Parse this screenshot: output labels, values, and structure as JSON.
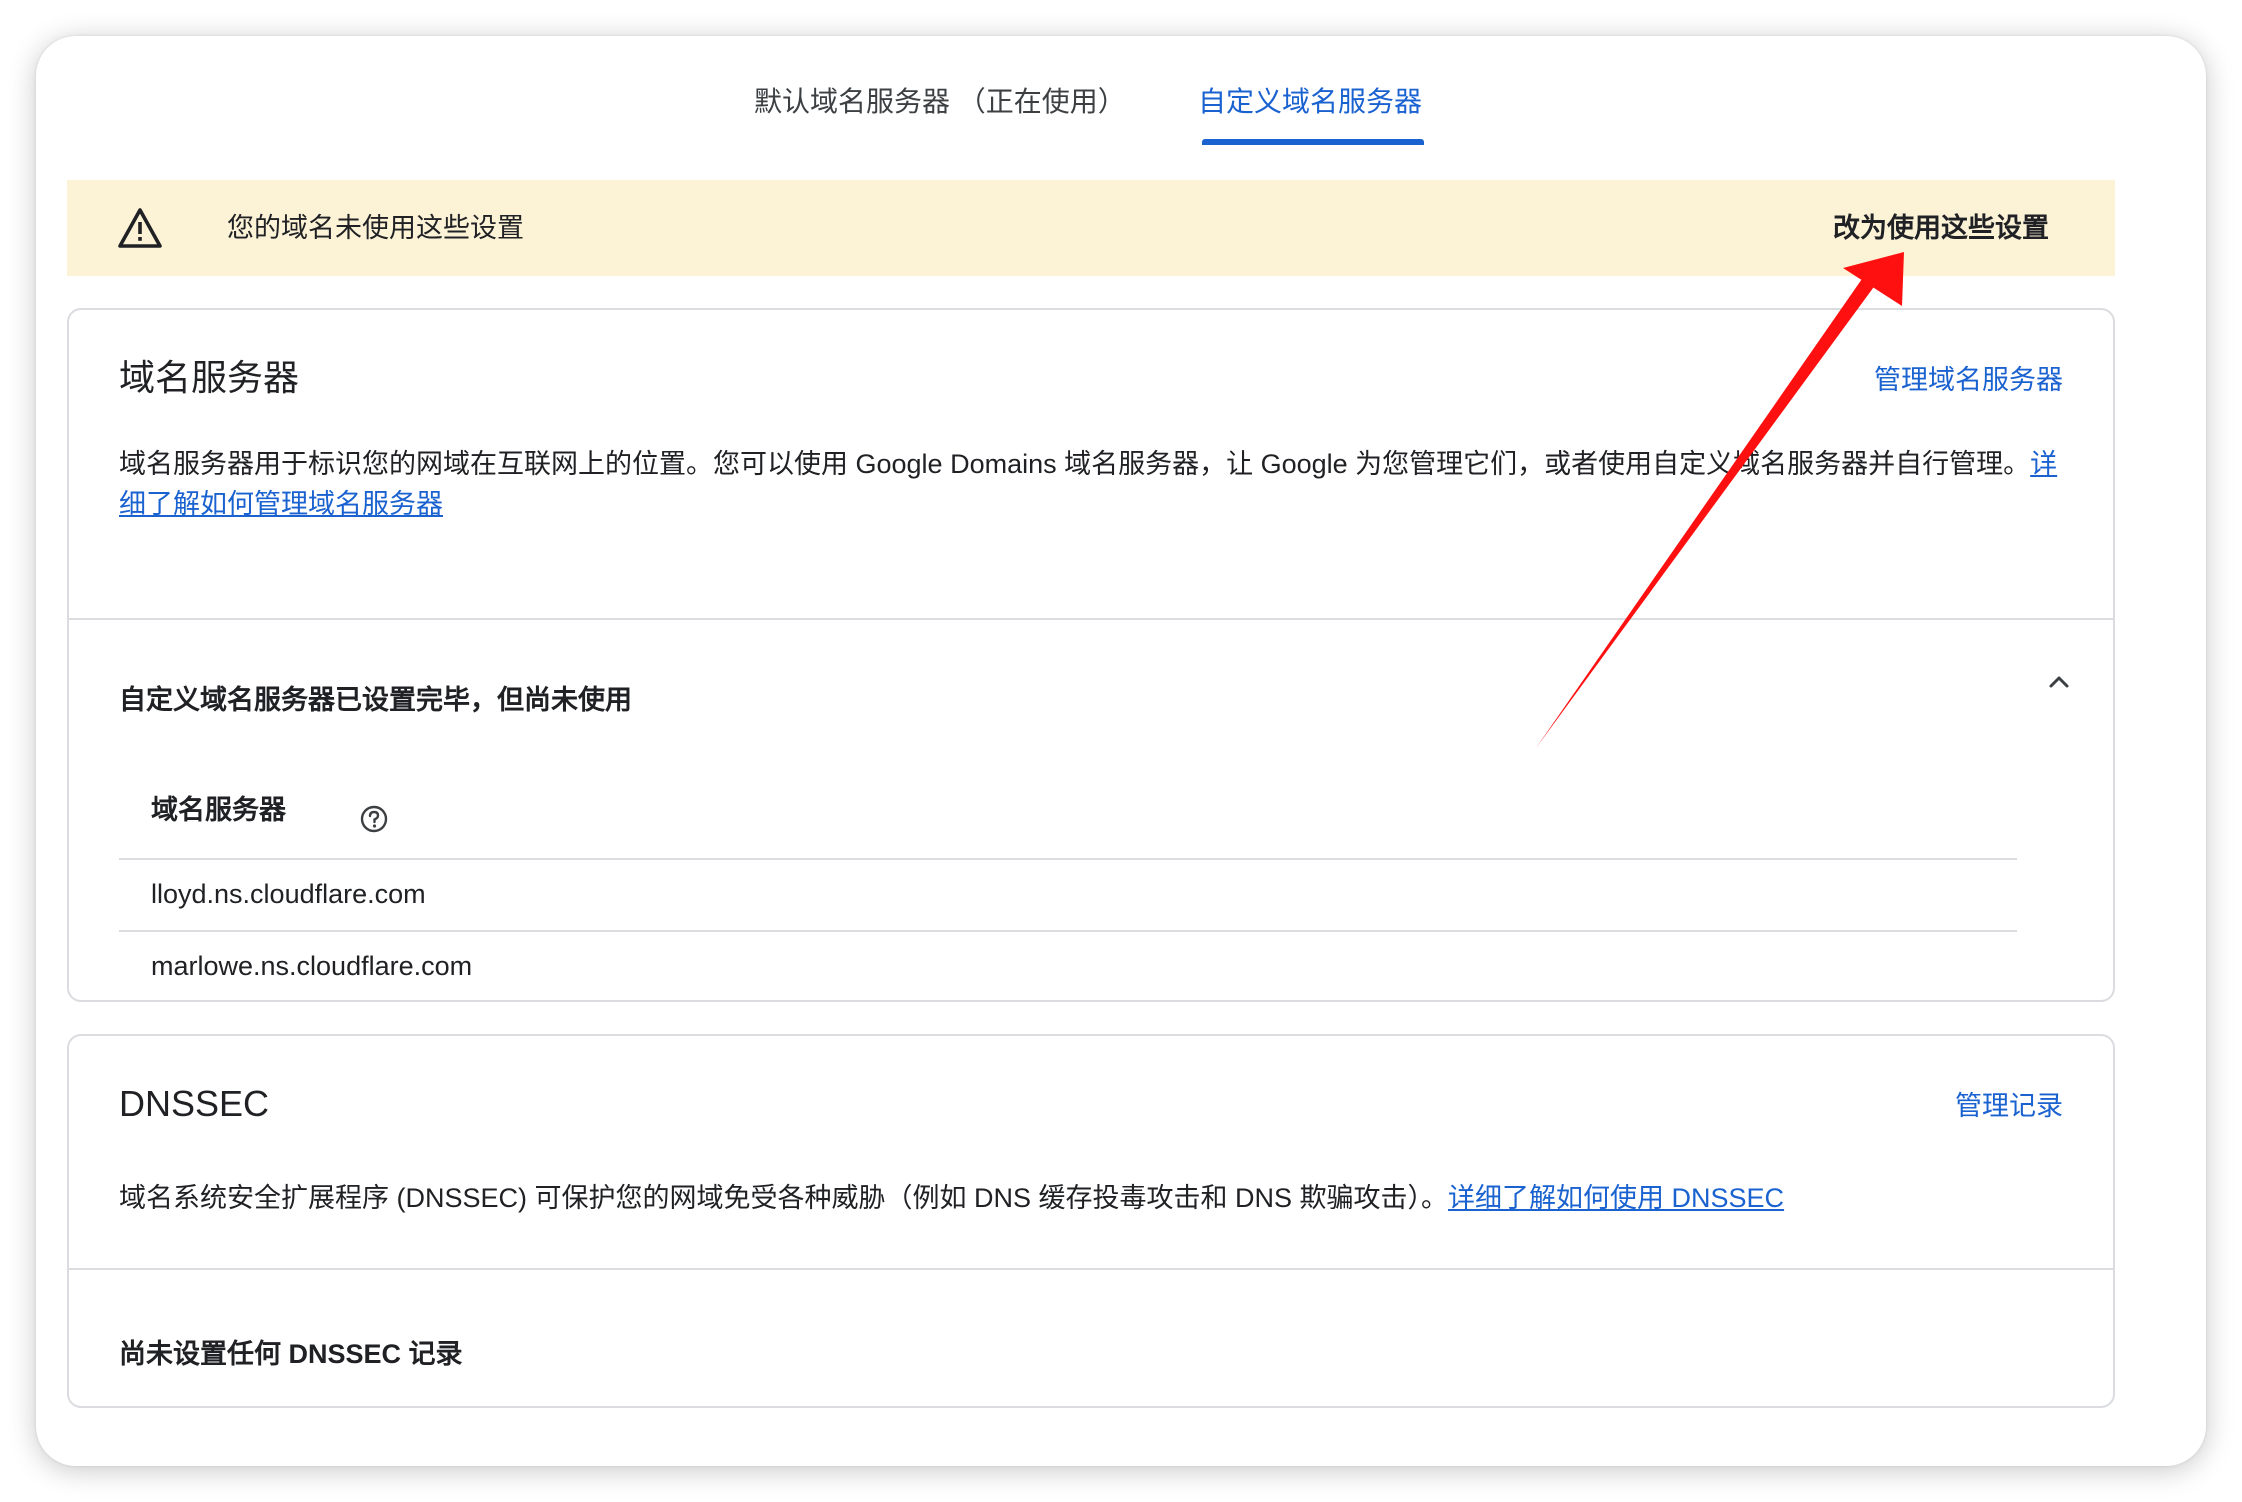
{
  "tabs": {
    "default_label": "默认域名服务器 （正在使用）",
    "custom_label": "自定义域名服务器"
  },
  "banner": {
    "icon": "warning-triangle-icon",
    "message": "您的域名未使用这些设置",
    "action_label": "改为使用这些设置"
  },
  "nameservers_card": {
    "title": "域名服务器",
    "manage_link": "管理域名服务器",
    "description": "域名服务器用于标识您的网域在互联网上的位置。您可以使用 Google Domains 域名服务器，让 Google 为您管理它们，或者使用自定义域名服务器并自行管理。",
    "learn_more_link": "详细了解如何管理域名服务器",
    "status_title": "自定义域名服务器已设置完毕，但尚未使用",
    "table_header": "域名服务器",
    "help_icon": "help-circle-icon",
    "rows": [
      "lloyd.ns.cloudflare.com",
      "marlowe.ns.cloudflare.com"
    ]
  },
  "dnssec_card": {
    "title": "DNSSEC",
    "manage_link": "管理记录",
    "description": "域名系统安全扩展程序 (DNSSEC) 可保护您的网域免受各种威胁（例如 DNS 缓存投毒攻击和 DNS 欺骗攻击）。",
    "learn_more_link": "详细了解如何使用 DNSSEC",
    "status_text": "尚未设置任何 DNSSEC 记录"
  },
  "colors": {
    "accent": "#1a62d0",
    "banner_background": "#fcf3d7",
    "annotation_arrow": "#ff1010"
  }
}
